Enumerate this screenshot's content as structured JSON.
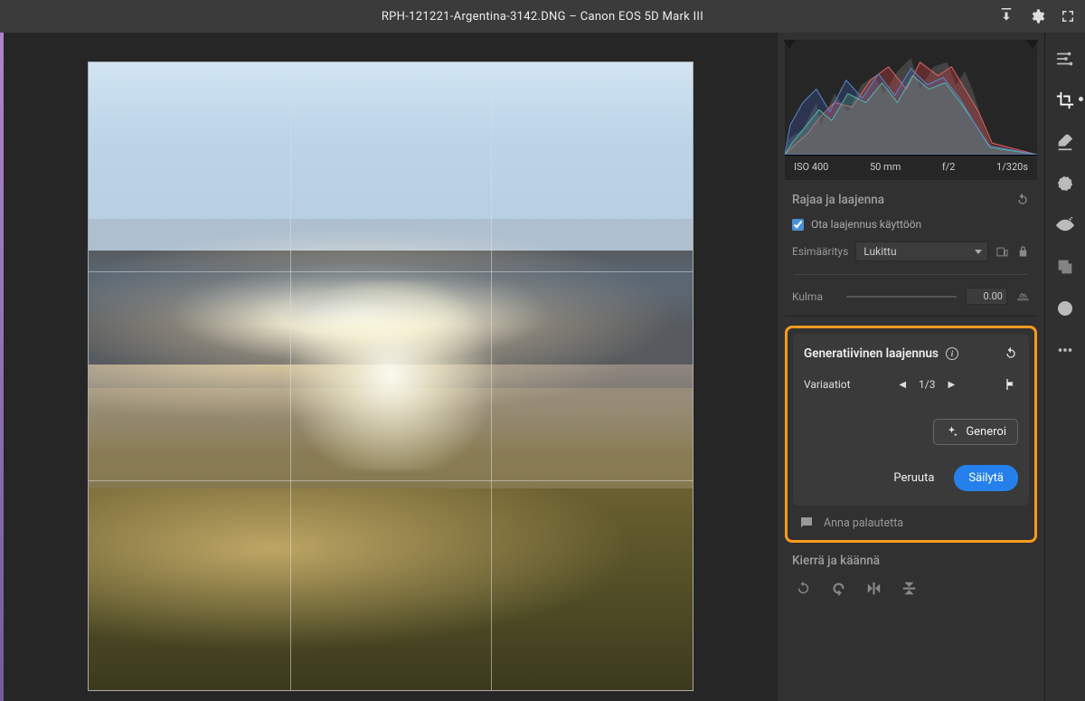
{
  "header": {
    "filename": "RPH-121221-Argentina-3142.DNG",
    "separator": "  –  ",
    "camera": "Canon EOS 5D Mark III"
  },
  "meta": {
    "iso": "ISO 400",
    "focal": "50 mm",
    "aperture": "f/2",
    "shutter": "1/320s"
  },
  "crop_panel": {
    "title": "Rajaa ja laajenna",
    "enable_expand": "Ota laajennus käyttöön",
    "enable_expand_checked": true,
    "preset_label": "Esimääritys",
    "preset_value": "Lukittu",
    "angle_label": "Kulma",
    "angle_value": "0.00"
  },
  "gen_panel": {
    "title": "Generatiivinen laajennus",
    "variations_label": "Variaatiot",
    "variation_pos": "1/3",
    "generate": "Generoi",
    "cancel": "Peruuta",
    "keep": "Säilytä",
    "feedback": "Anna palautetta"
  },
  "rotate_panel": {
    "title": "Kierrä ja käännä"
  },
  "tools": [
    "sliders-icon",
    "crop-icon",
    "eraser-icon",
    "radial-icon",
    "redeye-icon",
    "layers-icon",
    "sphere-icon",
    "more-icon"
  ]
}
